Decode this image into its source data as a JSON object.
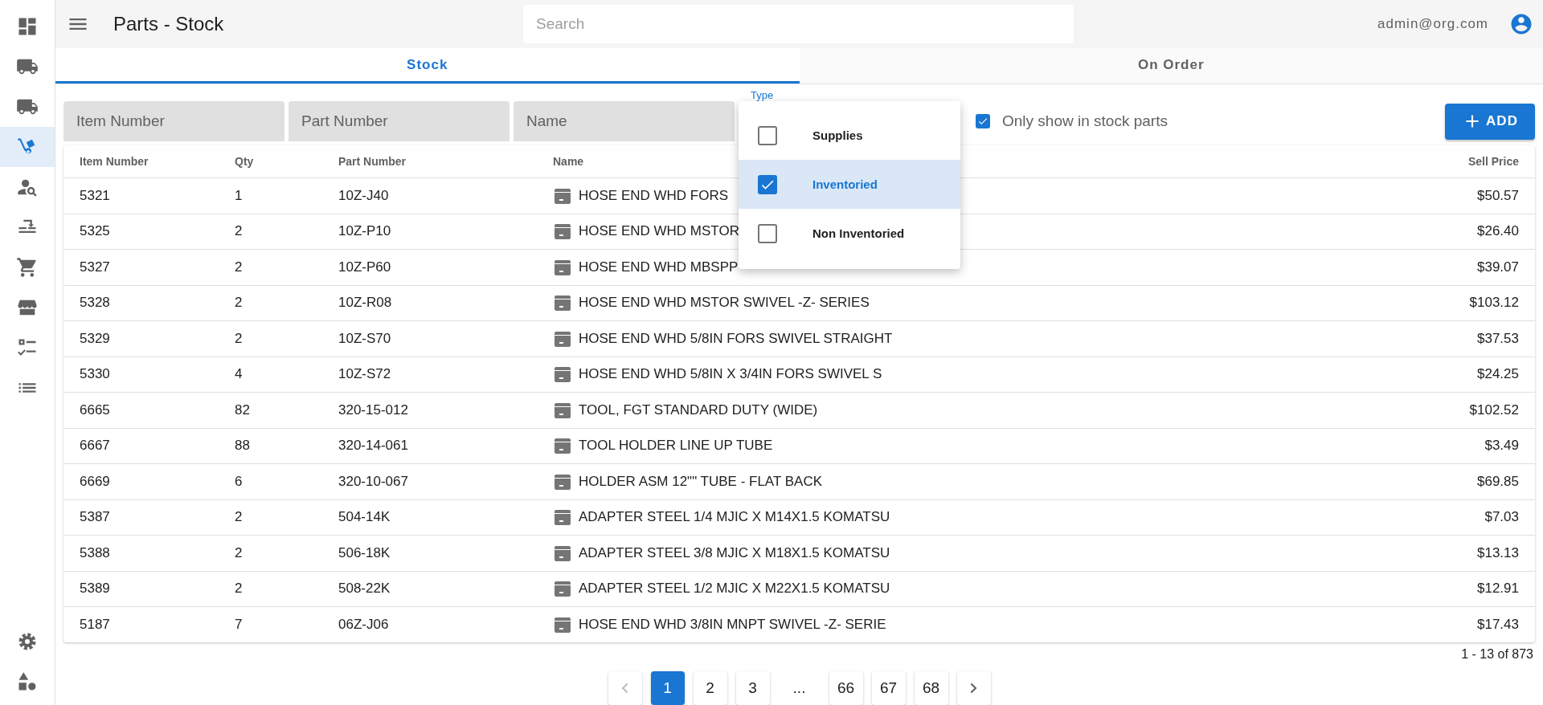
{
  "sidebar": {
    "items": [
      {
        "kind": "dashboard",
        "selected": false
      },
      {
        "kind": "truck",
        "selected": false
      },
      {
        "kind": "truck",
        "selected": false
      },
      {
        "kind": "dolly",
        "selected": true
      },
      {
        "kind": "person-search",
        "selected": false
      },
      {
        "kind": "transfer",
        "selected": false
      },
      {
        "kind": "cart",
        "selected": false
      },
      {
        "kind": "store",
        "selected": false
      },
      {
        "kind": "checklist",
        "selected": false
      },
      {
        "kind": "list",
        "selected": false
      }
    ],
    "bottom_items": [
      {
        "kind": "settings",
        "selected": false
      },
      {
        "kind": "shapes",
        "selected": false
      }
    ]
  },
  "app_bar": {
    "title": "Parts - Stock",
    "search": {
      "placeholder": "Search"
    },
    "user": "admin@org.com"
  },
  "tabs": [
    {
      "label": "Stock",
      "selected": true
    },
    {
      "label": "On Order",
      "selected": false
    }
  ],
  "filters": {
    "fields": [
      {
        "placeholder": "Item Number"
      },
      {
        "placeholder": "Part Number"
      },
      {
        "placeholder": "Name"
      }
    ],
    "type": {
      "label": "Type",
      "options": [
        {
          "label": "Supplies",
          "checked": false
        },
        {
          "label": "Inventoried",
          "checked": true
        },
        {
          "label": "Non Inventoried",
          "checked": false
        }
      ]
    },
    "in_stock_only": {
      "label": "Only show in stock parts",
      "checked": true
    },
    "add_button": "ADD"
  },
  "table": {
    "columns": [
      "Item Number",
      "Qty",
      "Part Number",
      "Name",
      "Sell Price"
    ],
    "rows": [
      {
        "item_number": "5321",
        "qty": "1",
        "part_number": "10Z-J40",
        "name": "HOSE END WHD FORS",
        "sell_price": "$50.57"
      },
      {
        "item_number": "5325",
        "qty": "2",
        "part_number": "10Z-P10",
        "name": "HOSE END WHD MSTOR",
        "sell_price": "$26.40"
      },
      {
        "item_number": "5327",
        "qty": "2",
        "part_number": "10Z-P60",
        "name": "HOSE END WHD MBSPP",
        "sell_price": "$39.07"
      },
      {
        "item_number": "5328",
        "qty": "2",
        "part_number": "10Z-R08",
        "name": "HOSE END WHD MSTOR SWIVEL -Z- SERIES",
        "sell_price": "$103.12"
      },
      {
        "item_number": "5329",
        "qty": "2",
        "part_number": "10Z-S70",
        "name": "HOSE END WHD 5/8IN FORS SWIVEL STRAIGHT",
        "sell_price": "$37.53"
      },
      {
        "item_number": "5330",
        "qty": "4",
        "part_number": "10Z-S72",
        "name": "HOSE END WHD 5/8IN X 3/4IN FORS SWIVEL S",
        "sell_price": "$24.25"
      },
      {
        "item_number": "6665",
        "qty": "82",
        "part_number": "320-15-012",
        "name": "TOOL, FGT STANDARD DUTY (WIDE)",
        "sell_price": "$102.52"
      },
      {
        "item_number": "6667",
        "qty": "88",
        "part_number": "320-14-061",
        "name": "TOOL HOLDER LINE UP TUBE",
        "sell_price": "$3.49"
      },
      {
        "item_number": "6669",
        "qty": "6",
        "part_number": "320-10-067",
        "name": "HOLDER ASM 12\"\" TUBE - FLAT BACK",
        "sell_price": "$69.85"
      },
      {
        "item_number": "5387",
        "qty": "2",
        "part_number": "504-14K",
        "name": "ADAPTER STEEL 1/4 MJIC X M14X1.5 KOMATSU",
        "sell_price": "$7.03"
      },
      {
        "item_number": "5388",
        "qty": "2",
        "part_number": "506-18K",
        "name": "ADAPTER STEEL 3/8 MJIC X M18X1.5 KOMATSU",
        "sell_price": "$13.13"
      },
      {
        "item_number": "5389",
        "qty": "2",
        "part_number": "508-22K",
        "name": "ADAPTER STEEL 1/2 MJIC X M22X1.5 KOMATSU",
        "sell_price": "$12.91"
      },
      {
        "item_number": "5187",
        "qty": "7",
        "part_number": "06Z-J06",
        "name": "HOSE END WHD 3/8IN MNPT SWIVEL -Z- SERIE",
        "sell_price": "$17.43"
      }
    ]
  },
  "footer": {
    "range": "1 - 13 of 873"
  },
  "pagination": {
    "prev": {
      "disabled": true
    },
    "next": {
      "disabled": false
    },
    "pages": [
      {
        "kind": "page",
        "label": "1",
        "selected": true
      },
      {
        "kind": "page",
        "label": "2",
        "selected": false
      },
      {
        "kind": "page",
        "label": "3",
        "selected": false
      },
      {
        "kind": "gap",
        "label": "..."
      },
      {
        "kind": "page",
        "label": "66",
        "selected": false
      },
      {
        "kind": "page",
        "label": "67",
        "selected": false
      },
      {
        "kind": "page",
        "label": "68",
        "selected": false
      }
    ]
  }
}
